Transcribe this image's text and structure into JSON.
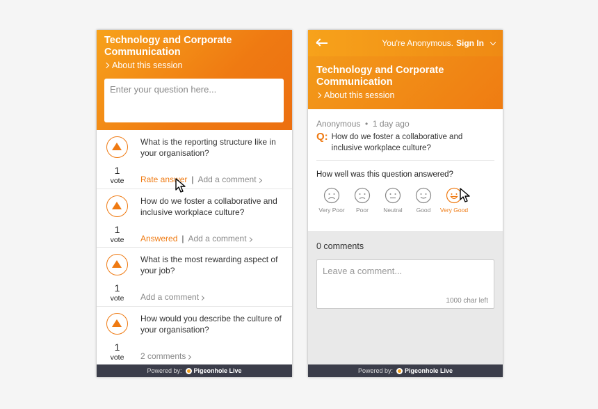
{
  "left": {
    "title_line1": "Technology and Corporate",
    "title_line2": "Communication",
    "about": "About this session",
    "question_placeholder": "Enter your question here...",
    "questions": [
      {
        "text": "What is the reporting structure like in your organisation?",
        "votes": "1",
        "vote_label": "vote",
        "primary": "Rate answer",
        "secondary": "Add a comment"
      },
      {
        "text": "How do we foster a collaborative and inclusive workplace culture?",
        "votes": "1",
        "vote_label": "vote",
        "primary": "Answered",
        "secondary": "Add a comment"
      },
      {
        "text": "What is the most rewarding aspect of your job?",
        "votes": "1",
        "vote_label": "vote",
        "secondary": "Add a comment"
      },
      {
        "text": "How would you describe the culture of your organisation?",
        "votes": "1",
        "vote_label": "vote",
        "secondary": "2 comments"
      }
    ]
  },
  "right": {
    "anon_text": "You're Anonymous.",
    "sign_in": "Sign In",
    "title_line1": "Technology and Corporate",
    "title_line2": "Communication",
    "about": "About this session",
    "author": "Anonymous",
    "time": "1 day ago",
    "q_prefix": "Q:",
    "question": "How do we foster a collaborative and inclusive workplace culture?",
    "rating_prompt": "How well was this question answered?",
    "ratings": [
      {
        "label": "Very Poor",
        "icon": "very-poor-face-icon"
      },
      {
        "label": "Poor",
        "icon": "poor-face-icon"
      },
      {
        "label": "Neutral",
        "icon": "neutral-face-icon"
      },
      {
        "label": "Good",
        "icon": "good-face-icon"
      },
      {
        "label": "Very Good",
        "icon": "very-good-face-icon",
        "selected": true
      }
    ],
    "comments_count": "0 comments",
    "comment_placeholder": "Leave a comment...",
    "char_left": "1000 char left"
  },
  "footer": {
    "powered_by": "Powered by:",
    "brand": "Pigeonhole Live"
  },
  "colors": {
    "accent": "#ef7a12",
    "footer_bg": "#3b3d4a"
  }
}
